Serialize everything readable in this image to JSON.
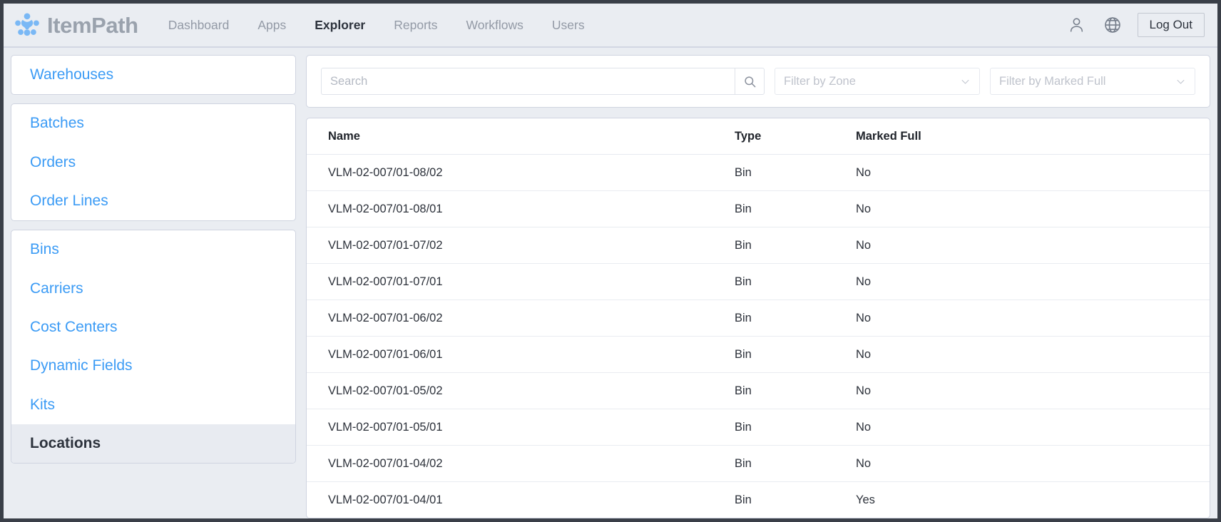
{
  "header": {
    "brand_name": "ItemPath",
    "brand_logo_icon": "itempath-dots-logo-icon",
    "nav": [
      {
        "label": "Dashboard",
        "active": false
      },
      {
        "label": "Apps",
        "active": false
      },
      {
        "label": "Explorer",
        "active": true
      },
      {
        "label": "Reports",
        "active": false
      },
      {
        "label": "Workflows",
        "active": false
      },
      {
        "label": "Users",
        "active": false
      }
    ],
    "account_icon": "user-icon",
    "language_icon": "globe-icon",
    "logout_label": "Log Out"
  },
  "sidebar": {
    "groups": [
      {
        "items": [
          {
            "label": "Warehouses",
            "active": false
          }
        ]
      },
      {
        "items": [
          {
            "label": "Batches",
            "active": false
          },
          {
            "label": "Orders",
            "active": false
          },
          {
            "label": "Order Lines",
            "active": false
          }
        ]
      },
      {
        "items": [
          {
            "label": "Bins",
            "active": false
          },
          {
            "label": "Carriers",
            "active": false
          },
          {
            "label": "Cost Centers",
            "active": false
          },
          {
            "label": "Dynamic Fields",
            "active": false
          },
          {
            "label": "Kits",
            "active": false
          },
          {
            "label": "Locations",
            "active": true
          }
        ]
      }
    ]
  },
  "filters": {
    "search": {
      "value": "",
      "placeholder": "Search"
    },
    "search_icon": "search-icon",
    "zone": {
      "selected": "",
      "placeholder": "Filter by Zone",
      "chevron_icon": "chevron-down-icon"
    },
    "marked_full": {
      "selected": "",
      "placeholder": "Filter by Marked Full",
      "chevron_icon": "chevron-down-icon"
    }
  },
  "table": {
    "columns": [
      "Name",
      "Type",
      "Marked Full"
    ],
    "rows": [
      {
        "name": "VLM-02-007/01-08/02",
        "type": "Bin",
        "marked_full": "No"
      },
      {
        "name": "VLM-02-007/01-08/01",
        "type": "Bin",
        "marked_full": "No"
      },
      {
        "name": "VLM-02-007/01-07/02",
        "type": "Bin",
        "marked_full": "No"
      },
      {
        "name": "VLM-02-007/01-07/01",
        "type": "Bin",
        "marked_full": "No"
      },
      {
        "name": "VLM-02-007/01-06/02",
        "type": "Bin",
        "marked_full": "No"
      },
      {
        "name": "VLM-02-007/01-06/01",
        "type": "Bin",
        "marked_full": "No"
      },
      {
        "name": "VLM-02-007/01-05/02",
        "type": "Bin",
        "marked_full": "No"
      },
      {
        "name": "VLM-02-007/01-05/01",
        "type": "Bin",
        "marked_full": "No"
      },
      {
        "name": "VLM-02-007/01-04/02",
        "type": "Bin",
        "marked_full": "No"
      },
      {
        "name": "VLM-02-007/01-04/01",
        "type": "Bin",
        "marked_full": "Yes"
      }
    ]
  },
  "colors": {
    "page_background": "#eaedf2",
    "card_background": "#ffffff",
    "link_blue": "#3b9bf5",
    "brand_gray": "#9aa2ad",
    "logo_blue": "#7ab8f5",
    "active_text": "#2d333d",
    "active_row_background": "#e8ebf1",
    "border": "#cfd4e0"
  }
}
